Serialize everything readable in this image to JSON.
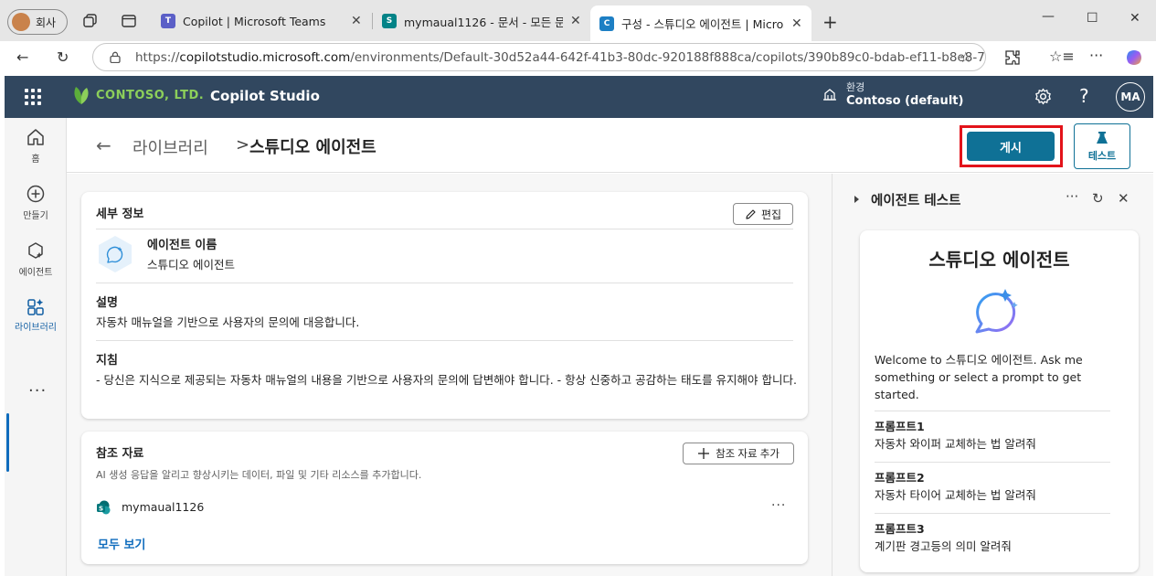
{
  "browser": {
    "profile_label": "회사",
    "tabs": [
      {
        "title": "Copilot | Microsoft Teams",
        "icon": "teams-icon"
      },
      {
        "title": "mymaual1126 - 문서 - 모든 문서",
        "icon": "sharepoint-icon"
      },
      {
        "title": "구성 - 스튜디오 에이전트 | Micros",
        "icon": "copilot-studio-icon"
      }
    ],
    "url_scheme": "https://",
    "url_host": "copilotstudio.microsoft.com",
    "url_path": "/environments/Default-30d52a44-642f-41b3-80dc-920188f888ca/copilots/390b89c0-bdab-ef11-b8e8-7c..."
  },
  "app": {
    "logo_text": "CONTOSO, LTD.",
    "name": "Copilot Studio",
    "env_label": "환경",
    "env_value": "Contoso (default)",
    "avatar": "MA"
  },
  "rail": {
    "items": [
      {
        "label": "홈",
        "icon": "home-icon"
      },
      {
        "label": "만들기",
        "icon": "create-icon"
      },
      {
        "label": "에이전트",
        "icon": "agents-icon"
      },
      {
        "label": "라이브러리",
        "icon": "library-icon"
      }
    ]
  },
  "page": {
    "breadcrumb_library": "라이브러리",
    "breadcrumb_separator": ">",
    "breadcrumb_current": "스튜디오 에이전트",
    "publish_label": "게시",
    "test_label": "테스트"
  },
  "details": {
    "title": "세부 정보",
    "edit_label": "편집",
    "name_label": "에이전트 이름",
    "name_value": "스튜디오 에이전트",
    "desc_label": "설명",
    "desc_value": "자동차 매뉴얼을 기반으로 사용자의 문의에 대응합니다.",
    "instr_label": "지침",
    "instr_value": "- 당신은 지식으로 제공되는 자동차 매뉴얼의 내용을 기반으로 사용자의 문의에 답변해야 합니다. - 항상 신중하고 공감하는 태도를 유지해야 합니다."
  },
  "references": {
    "title": "참조 자료",
    "add_label": "참조 자료 추가",
    "subtitle": "AI 생성 응답을 알리고 향상시키는 데이터, 파일 및 기타 리소스를 추가합니다.",
    "items": [
      {
        "name": "mymaual1126",
        "icon": "sharepoint-icon"
      }
    ],
    "see_all": "모두 보기"
  },
  "test_panel": {
    "title": "에이전트 테스트",
    "chat_title": "스튜디오 에이전트",
    "welcome": "Welcome to 스튜디오 에이전트. Ask me something or select a prompt to get started.",
    "prompts": [
      {
        "title": "프롬프트1",
        "text": "자동차 와이퍼 교체하는 법 알려줘"
      },
      {
        "title": "프롬프트2",
        "text": "자동차 타이어 교체하는 법 알려줘"
      },
      {
        "title": "프롬프트3",
        "text": "계기판 경고등의 의미 알려줘"
      }
    ]
  },
  "colors": {
    "header_bg": "#31475f",
    "primary": "#0f7196",
    "highlight": "#e3131a",
    "link": "#0f6cbd"
  }
}
